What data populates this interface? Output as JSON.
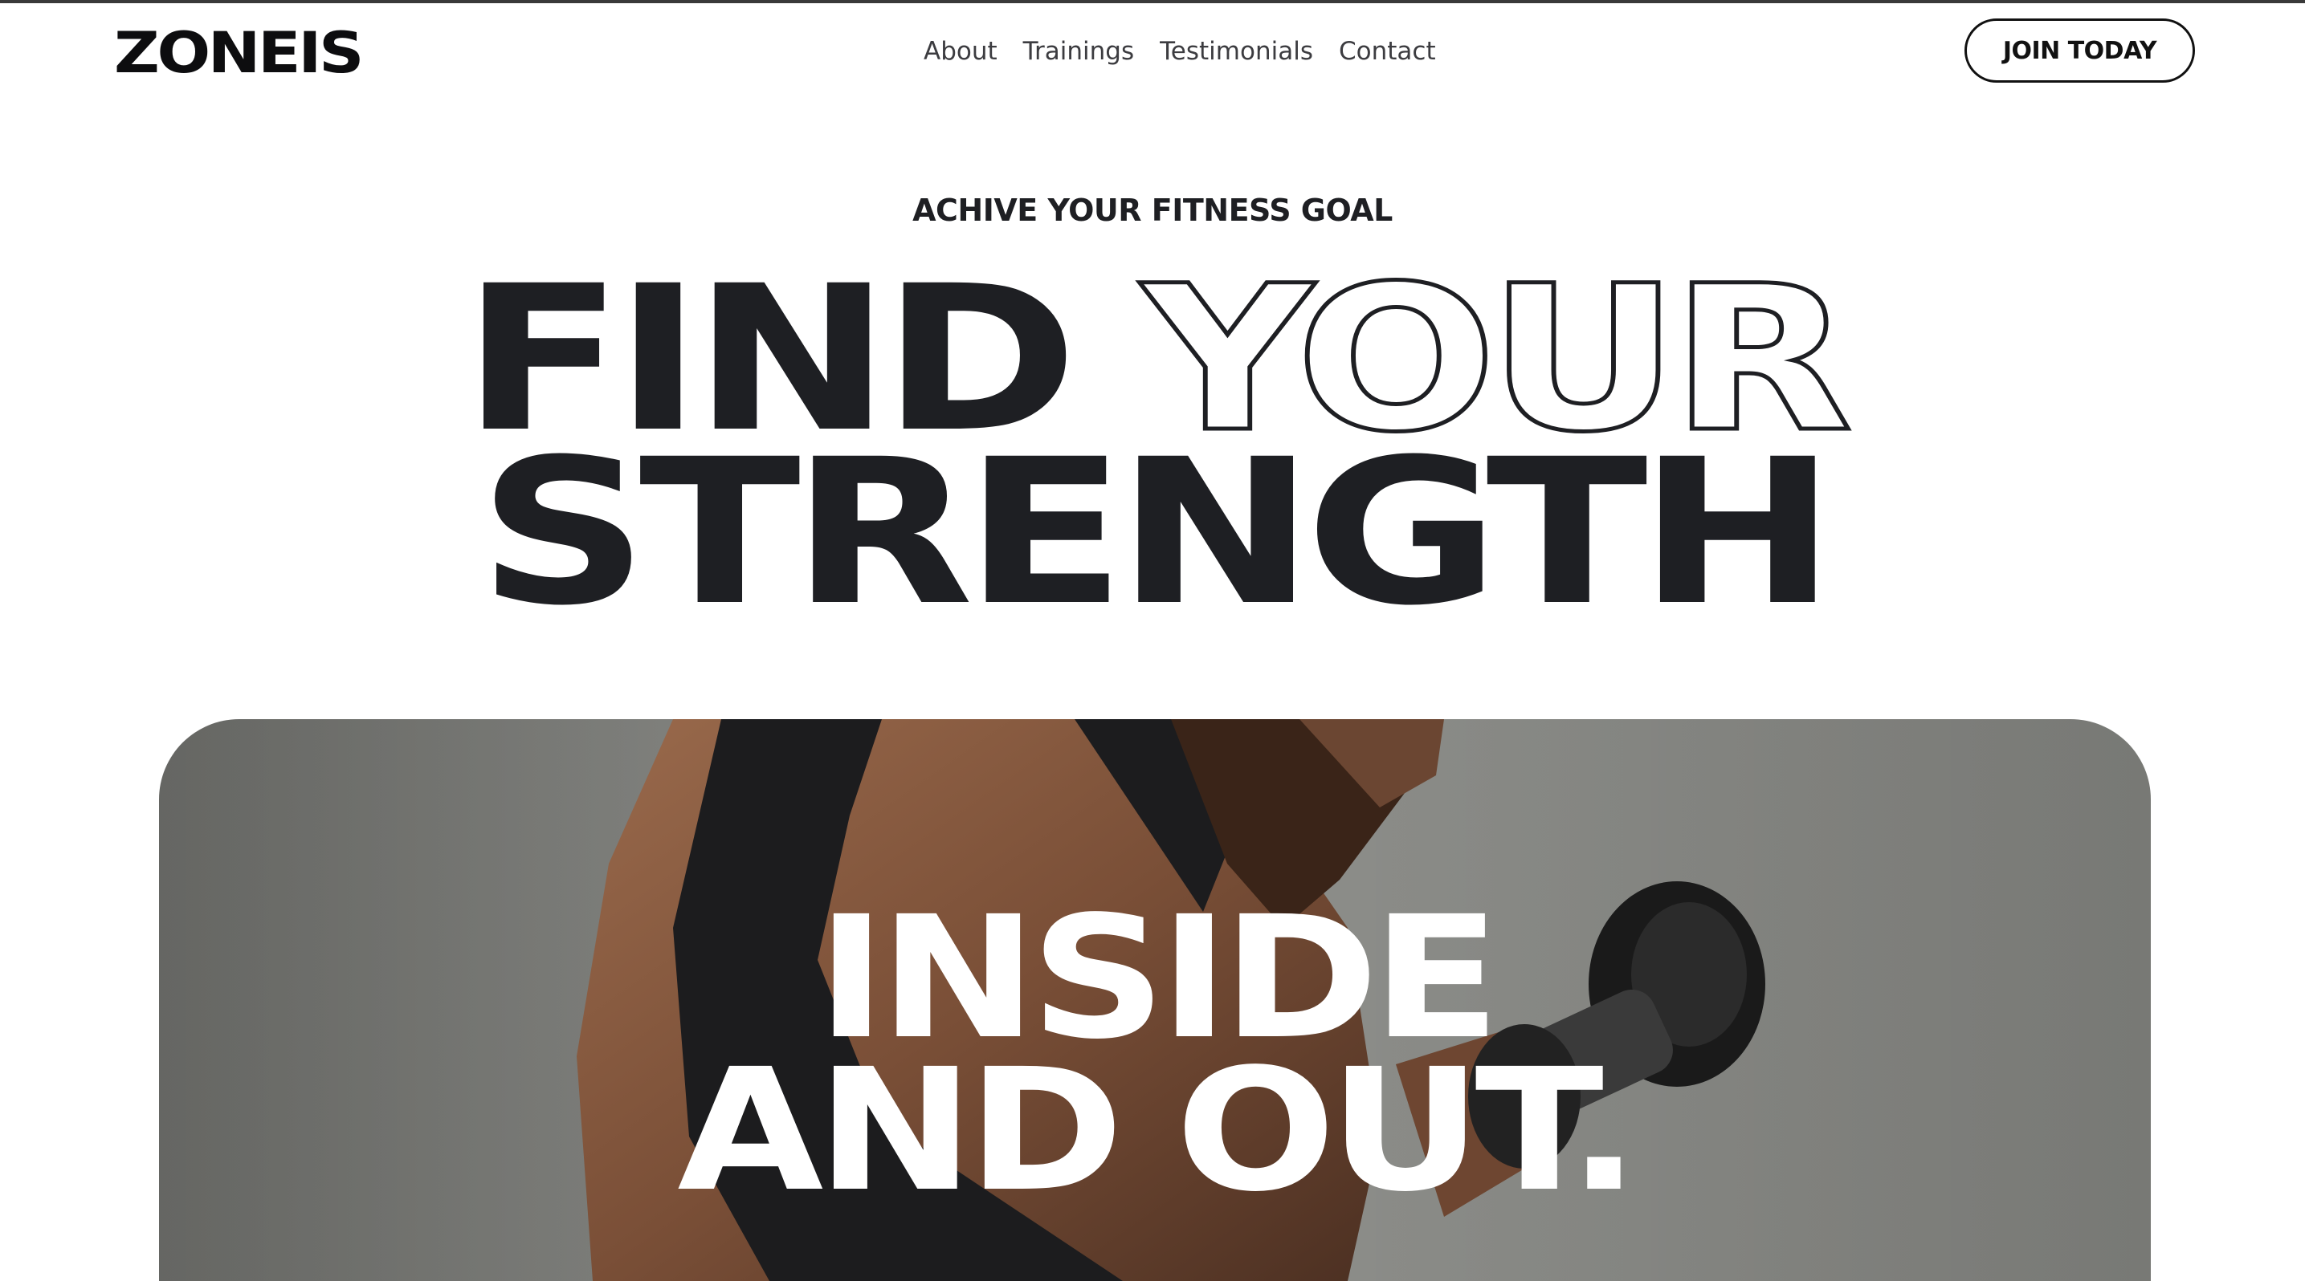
{
  "brand": {
    "logo_text": "ZONEIS"
  },
  "nav": {
    "items": [
      {
        "label": "About"
      },
      {
        "label": "Trainings"
      },
      {
        "label": "Testimonials"
      },
      {
        "label": "Contact"
      }
    ]
  },
  "cta": {
    "join_label": "JOIN TODAY"
  },
  "hero": {
    "eyebrow": "ACHIVE YOUR FITNESS GOAL",
    "headline_word1": "FIND",
    "headline_word2": "YOUR",
    "headline_line2": "STRENGTH",
    "image_line1": "INSIDE",
    "image_line2": "AND OUT."
  },
  "colors": {
    "text_dark": "#1e1f23",
    "background": "#ffffff",
    "hero_bg": "#8b8c88"
  },
  "icons": [
    "woman-lifting-dumbbell-photo"
  ]
}
